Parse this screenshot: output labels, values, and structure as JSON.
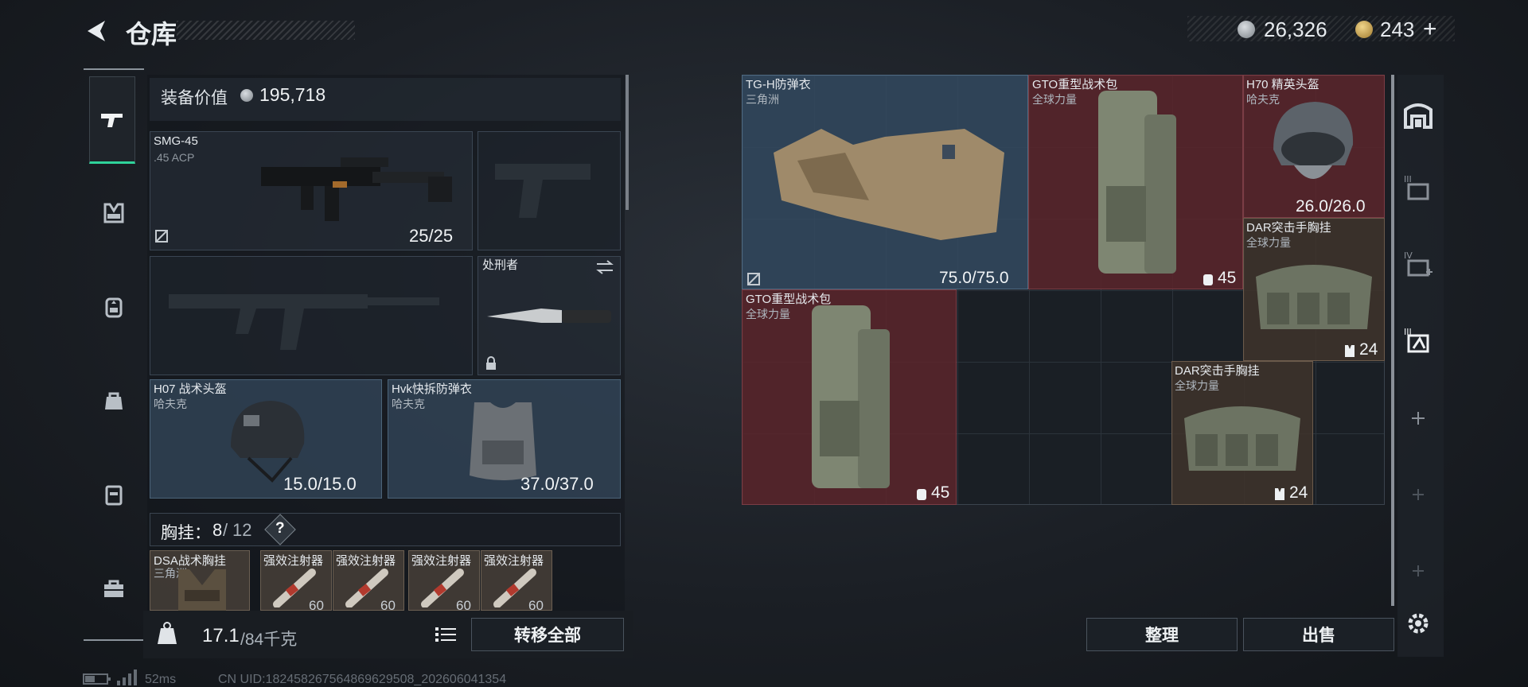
{
  "header": {
    "title": "仓库"
  },
  "currency": {
    "silver": "26,326",
    "gold": "243",
    "plus": "+"
  },
  "left": {
    "equip_value_label": "装备价值",
    "equip_value": "195,718",
    "weapon": {
      "name": "SMG-45",
      "ammo": ".45 ACP",
      "durability": "25/25"
    },
    "melee": {
      "name": "处刑者"
    },
    "helmet": {
      "name": "H07 战术头盔",
      "maker": "哈夫克",
      "durability": "15.0/15.0"
    },
    "armor": {
      "name": "Hvk快拆防弹衣",
      "maker": "哈夫克",
      "durability": "37.0/37.0"
    },
    "chest_rig": {
      "label": "胸挂：",
      "used": "8",
      "sep": "/",
      "cap": "12",
      "help": "?"
    },
    "rig_item": {
      "name": "DSA战术胸挂",
      "maker": "三角洲"
    },
    "injectors": [
      {
        "name": "强效注射器",
        "count": "60"
      },
      {
        "name": "强效注射器",
        "count": "60"
      },
      {
        "name": "强效注射器",
        "count": "60"
      },
      {
        "name": "强效注射器",
        "count": "60"
      }
    ],
    "weight": {
      "current": "17.1",
      "max": "/84千克"
    },
    "transfer_all": "转移全部"
  },
  "storage": {
    "items": [
      {
        "name": "TG-H防弹衣",
        "maker": "三角洲",
        "value": "75.0/75.0"
      },
      {
        "name": "GTO重型战术包",
        "maker": "全球力量",
        "value": "45"
      },
      {
        "name": "H70 精英头盔",
        "maker": "哈夫克",
        "value": "26.0/26.0"
      },
      {
        "name": "DAR突击手胸挂",
        "maker": "全球力量",
        "value": "24"
      },
      {
        "name": "GTO重型战术包",
        "maker": "全球力量",
        "value": "45"
      },
      {
        "name": "DAR突击手胸挂",
        "maker": "全球力量",
        "value": "24"
      }
    ],
    "sort_button": "整理",
    "sell_button": "出售"
  },
  "statusbar": {
    "ping": "52ms",
    "uid": "CN UID:182458267564869629508_202606041354"
  },
  "colors": {
    "accent_green": "#2fd39a",
    "item_blue": "#344a60",
    "item_red": "#5c262c",
    "item_brown": "#40342c"
  }
}
